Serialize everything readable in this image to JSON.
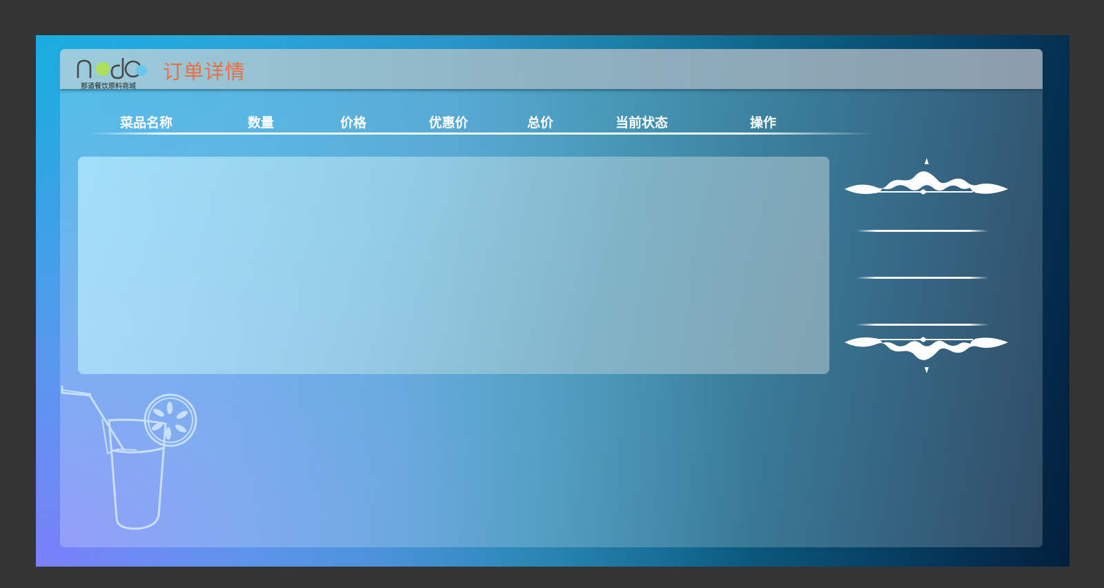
{
  "header": {
    "logo_text": "nado",
    "logo_subtitle": "那道餐饮原料商城",
    "title": "订单详情"
  },
  "table": {
    "columns": [
      "菜品名称",
      "数量",
      "价格",
      "优惠价",
      "总价",
      "当前状态",
      "操作"
    ]
  },
  "colors": {
    "title_orange": "#ef6d42",
    "page_background": "#343434"
  },
  "icons": {
    "logo": "nado-logo-icon",
    "drink": "drink-illustration-icon",
    "ornament": "ornamental-scroll-icon"
  }
}
